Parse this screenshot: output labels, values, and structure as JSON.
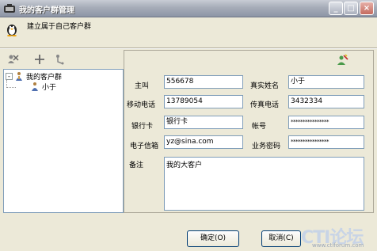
{
  "window": {
    "title": "我的客户群管理",
    "controls": {
      "minimize": "_",
      "maximize": "□",
      "close": "×"
    }
  },
  "header": {
    "text": "建立属于自己客户群"
  },
  "toolbar": {
    "icons": [
      "delete-person-icon",
      "add-icon",
      "move-icon"
    ]
  },
  "tree": {
    "root": {
      "label": "我的客户群",
      "toggle": "-"
    },
    "children": [
      {
        "label": "小于"
      }
    ]
  },
  "form": {
    "title_icon": "edit-person-icon",
    "fields": {
      "phone": {
        "label": "主叫",
        "value": "556678"
      },
      "real_name": {
        "label": "真实姓名",
        "value": "小于"
      },
      "mobile": {
        "label": "移动电话",
        "value": "13789054"
      },
      "fax": {
        "label": "传真电话",
        "value": "3432334"
      },
      "bank_card": {
        "label": "银行卡",
        "value": "银行卡"
      },
      "account": {
        "label": "帐号",
        "value": "****************"
      },
      "email": {
        "label": "电子信箱",
        "value": "yz@sina.com"
      },
      "business_password": {
        "label": "业务密码",
        "value": "****************"
      },
      "notes": {
        "label": "备注",
        "value": "我的大客户"
      }
    }
  },
  "buttons": {
    "ok": "确定(O)",
    "cancel": "取消(C)"
  },
  "watermark": {
    "main": "CTI论坛",
    "sub": "www.ctiforum.com"
  }
}
